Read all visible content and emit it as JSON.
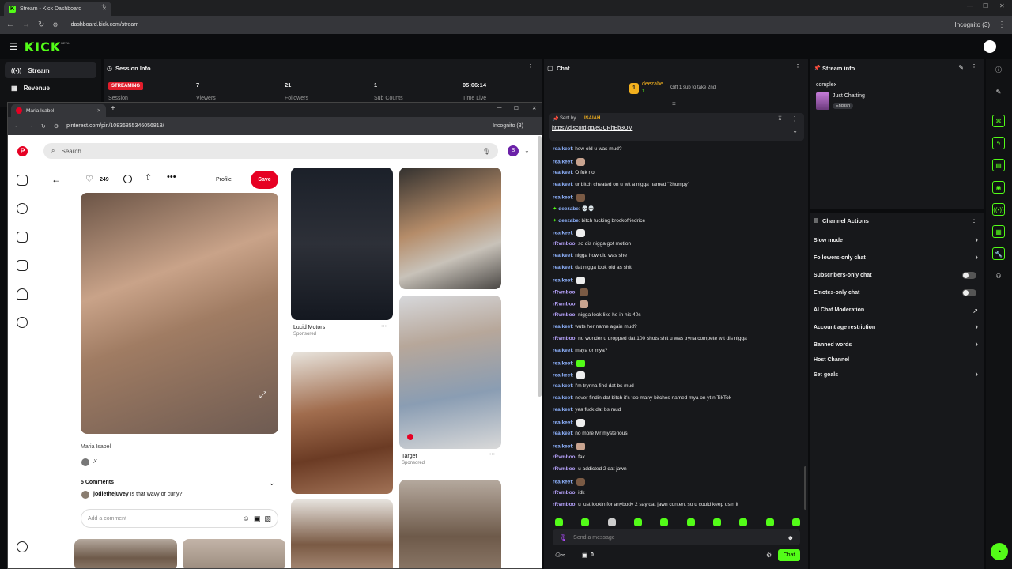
{
  "browser": {
    "tab_title": "Stream - Kick Dashboard",
    "url": "dashboard.kick.com/stream",
    "incognito": "Incognito (3)"
  },
  "kick": {
    "logo": "KICK",
    "beta": "BETA"
  },
  "nav": [
    {
      "label": "Stream"
    },
    {
      "label": "Revenue"
    }
  ],
  "session": {
    "title": "Session Info",
    "status": "STREAMING",
    "stats": [
      {
        "value": "7",
        "label": "Session"
      },
      {
        "value": "7",
        "label": "Viewers"
      },
      {
        "value": "21",
        "label": "Followers"
      },
      {
        "value": "1",
        "label": "Sub Counts"
      },
      {
        "value": "05:06:14",
        "label": "Time Live"
      }
    ]
  },
  "popup": {
    "tab_title": "Maria Isabel",
    "url": "pinterest.com/pin/10836855346056818/",
    "incognito": "Incognito (3)"
  },
  "pinterest": {
    "search_placeholder": "Search",
    "likes": "249",
    "profile_label": "Profile",
    "save_label": "Save",
    "pin_title": "Maria Isabel",
    "pin_author_initial": "X",
    "comments_header": "5 Comments",
    "comment_user": "jodiethejuvey",
    "comment_text": "Is that wavy or curly?",
    "add_comment_placeholder": "Add a comment",
    "avatar_initial": "S",
    "pin2_title": "Lucid Motors",
    "pin2_sub": "Sponsored",
    "pin3_title": "Target",
    "pin3_sub": "Sponsored"
  },
  "chat": {
    "title": "Chat",
    "top_user": "deezabe",
    "top_user_count": "1",
    "gift_text": "Gift 1 sub to take 2nd",
    "pinned_sent_by": "Sent by",
    "pinned_user": "ISAIAH",
    "pinned_link": "https://discord.gg/eGCRhEb3QM",
    "messages": [
      {
        "user": "realkeef",
        "text": "how old u was mud?",
        "cls": "un1"
      },
      {
        "user": "realkeef",
        "text": "",
        "cls": "un1",
        "emote": true
      },
      {
        "user": "realkeef",
        "text": "O fuk no",
        "cls": "un1"
      },
      {
        "user": "realkeef",
        "text": "ur bitch cheated on u wit a nigga named \"2humpy\"",
        "cls": "un1"
      },
      {
        "user": "realkeef",
        "text": "",
        "cls": "un1",
        "emote": true
      },
      {
        "user": "deezabe",
        "text": "💀💀",
        "cls": "un1"
      },
      {
        "user": "deezabe",
        "text": "bitch fucking brockofriedrice",
        "cls": "un1"
      },
      {
        "user": "realkeef",
        "text": "",
        "cls": "un1",
        "emote": true
      },
      {
        "user": "rRvmboo",
        "text": "so dis nigga got motion",
        "cls": "un2"
      },
      {
        "user": "realkeef",
        "text": "nigga how old was she",
        "cls": "un1"
      },
      {
        "user": "realkeef",
        "text": "dat nigga look old as shit",
        "cls": "un1"
      },
      {
        "user": "realkeef",
        "text": "",
        "cls": "un1",
        "emote": true
      },
      {
        "user": "rRvmboo",
        "text": "",
        "cls": "un2",
        "emote": true
      },
      {
        "user": "rRvmboo",
        "text": "",
        "cls": "un2",
        "emote": true
      },
      {
        "user": "rRvmboo",
        "text": "nigga look like he in his 40s",
        "cls": "un2"
      },
      {
        "user": "realkeef",
        "text": "wuts her name again mud?",
        "cls": "un1"
      },
      {
        "user": "rRvmboo",
        "text": "no wonder u dropped dat 100 shots shit u was tryna compete wit dis nigga",
        "cls": "un2"
      },
      {
        "user": "realkeef",
        "text": "maya or mya?",
        "cls": "un1"
      },
      {
        "user": "realkeef",
        "text": "",
        "cls": "un1",
        "emote": true
      },
      {
        "user": "realkeef",
        "text": "",
        "cls": "un1",
        "emote": true
      },
      {
        "user": "realkeef",
        "text": "I'm trynna find dat bs mud",
        "cls": "un1"
      },
      {
        "user": "realkeef",
        "text": "never findin dat bitch it's too many bitches named mya on yt n TikTok",
        "cls": "un1"
      },
      {
        "user": "realkeef",
        "text": "yea fuck dat bs mud",
        "cls": "un1"
      },
      {
        "user": "realkeef",
        "text": "",
        "cls": "un1",
        "emote": true
      },
      {
        "user": "realkeef",
        "text": "no more Mr mysterious",
        "cls": "un1"
      },
      {
        "user": "realkeef",
        "text": "",
        "cls": "un1",
        "emote": true
      },
      {
        "user": "rRvmboo",
        "text": "fax",
        "cls": "un2"
      },
      {
        "user": "rRvmboo",
        "text": "u addicted 2 dat jawn",
        "cls": "un2"
      },
      {
        "user": "realkeef",
        "text": "",
        "cls": "un1",
        "emote": true
      },
      {
        "user": "rRvmboo",
        "text": "idk",
        "cls": "un2"
      },
      {
        "user": "rRvmboo",
        "text": "u just lookin for anybody 2 say dat jawn content so u could keep usin it",
        "cls": "un2"
      }
    ],
    "input_placeholder": "Send a message",
    "viewer_count": "0",
    "chat_button": "Chat"
  },
  "stream_info": {
    "title": "Stream info",
    "stream_title": "complex",
    "category": "Just Chatting",
    "language": "English"
  },
  "channel_actions": {
    "title": "Channel Actions",
    "items": [
      {
        "label": "Slow mode",
        "control": "chevron"
      },
      {
        "label": "Followers-only chat",
        "control": "chevron"
      },
      {
        "label": "Subscribers-only chat",
        "control": "toggle"
      },
      {
        "label": "Emotes-only chat",
        "control": "toggle"
      },
      {
        "label": "AI Chat Moderation",
        "control": "external"
      },
      {
        "label": "Account age restriction",
        "control": "chevron"
      },
      {
        "label": "Banned words",
        "control": "chevron"
      },
      {
        "label": "Host Channel",
        "control": "none"
      },
      {
        "label": "Set goals",
        "control": "chevron"
      }
    ]
  },
  "colors": {
    "kick_green": "#53fc18",
    "pinterest_red": "#e60023",
    "live_red": "#e11d2b"
  }
}
